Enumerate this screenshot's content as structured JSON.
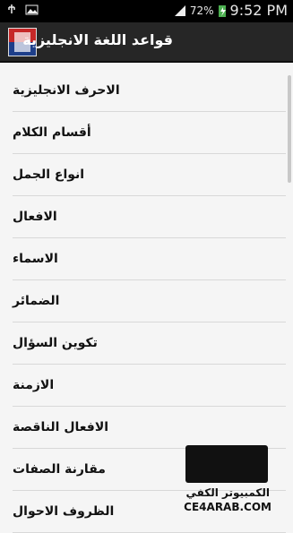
{
  "status": {
    "battery": "72%",
    "time": "9:52 PM"
  },
  "header": {
    "title": "قواعد اللغة الانجليزية"
  },
  "items": [
    {
      "label": "الاحرف الانجليزية"
    },
    {
      "label": "أقسام الكلام"
    },
    {
      "label": "انواع الجمل"
    },
    {
      "label": "الافعال"
    },
    {
      "label": "الاسماء"
    },
    {
      "label": "الضمائر"
    },
    {
      "label": "تكوين السؤال"
    },
    {
      "label": "الازمنة"
    },
    {
      "label": "الافعال الناقصة"
    },
    {
      "label": "مقارنة الصفات"
    },
    {
      "label": "الظروف الاحوال"
    }
  ],
  "watermark": {
    "ar": "الكمبيوتر الكفي",
    "en": "CE4ARAB.COM"
  }
}
